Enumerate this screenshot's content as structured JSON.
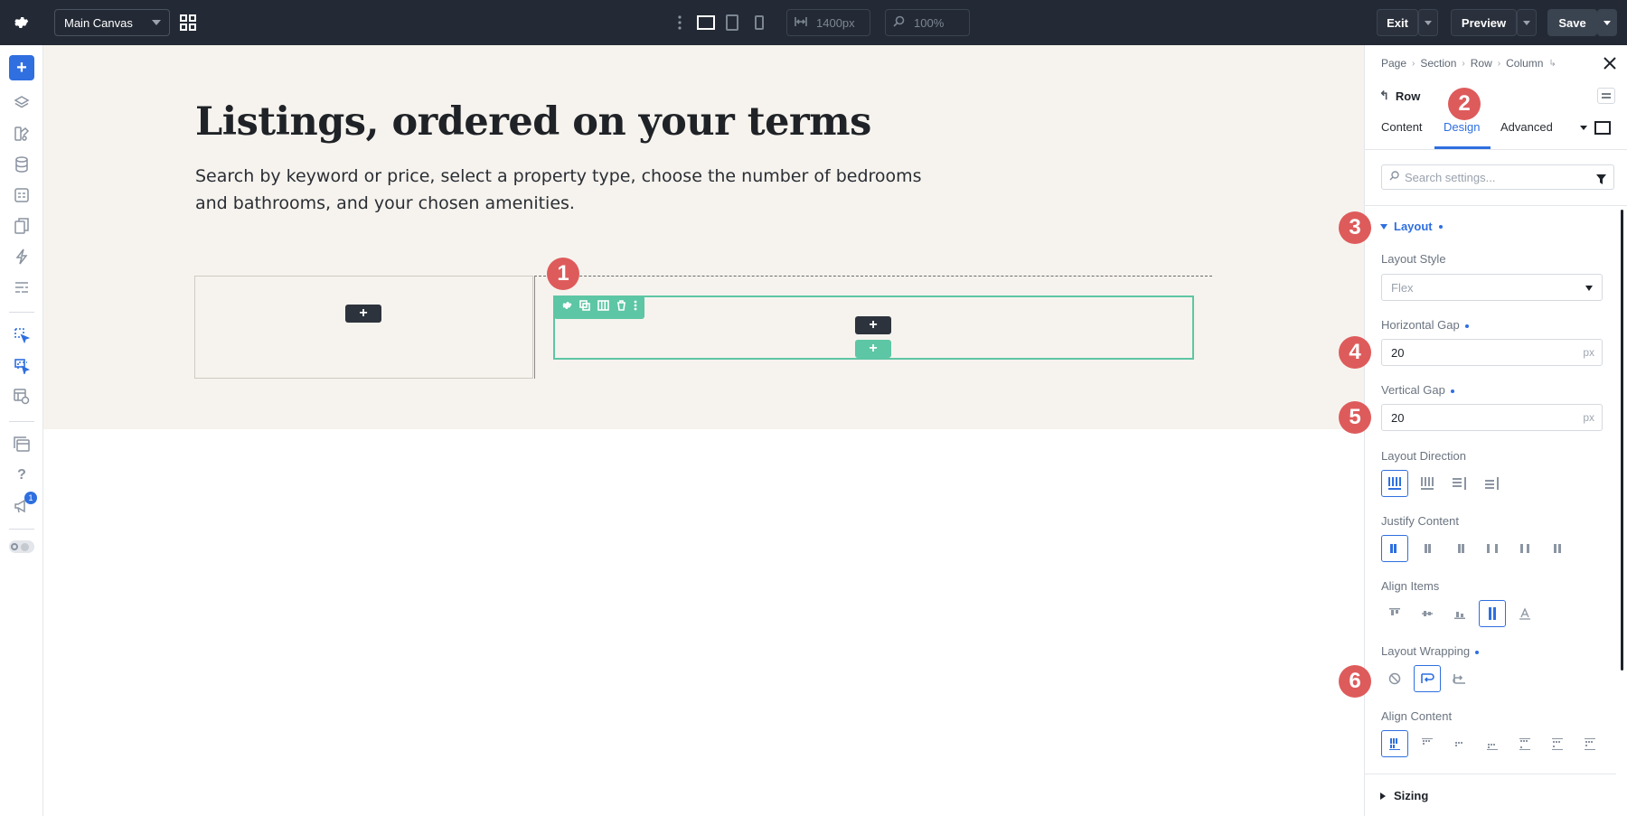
{
  "topbar": {
    "canvas_select": "Main Canvas",
    "width_value": "1400px",
    "zoom_value": "100%",
    "exit_label": "Exit",
    "preview_label": "Preview",
    "save_label": "Save"
  },
  "leftbar": {
    "notification_count": "1"
  },
  "canvas": {
    "heading": "Listings, ordered on your terms",
    "paragraph": "Search by keyword or price, select a property type, choose the number of bedrooms and bathrooms, and your chosen amenities.",
    "add_symbol": "+"
  },
  "markers": [
    "1",
    "2",
    "3",
    "4",
    "5",
    "6"
  ],
  "panel": {
    "breadcrumb": [
      "Page",
      "Section",
      "Row",
      "Column"
    ],
    "element_title": "Row",
    "tabs": [
      "Content",
      "Design",
      "Advanced"
    ],
    "active_tab": "Design",
    "search_placeholder": "Search settings...",
    "layout_group": "Layout",
    "layout_style_label": "Layout Style",
    "layout_style_value": "Flex",
    "horizontal_gap_label": "Horizontal Gap",
    "horizontal_gap_value": "20",
    "vertical_gap_label": "Vertical Gap",
    "vertical_gap_value": "20",
    "unit": "px",
    "layout_direction_label": "Layout Direction",
    "justify_content_label": "Justify Content",
    "align_items_label": "Align Items",
    "layout_wrapping_label": "Layout Wrapping",
    "align_content_label": "Align Content",
    "sizing_group": "Sizing"
  },
  "colors": {
    "topbar_bg": "#232a35",
    "accent_blue": "#2f6fe0",
    "row_green": "#5dc6a4",
    "marker_red": "#de5b5b",
    "section_bg": "#f6f3ee"
  }
}
